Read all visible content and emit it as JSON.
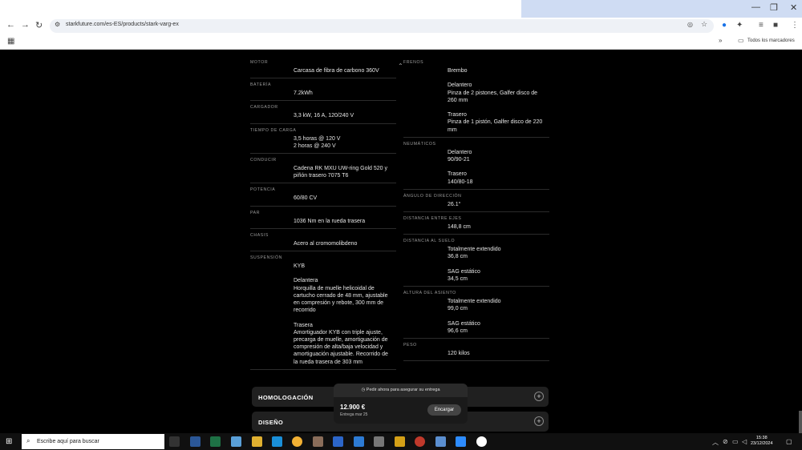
{
  "browser": {
    "url": "starkfuture.com/es-ES/products/stark-varg-ex",
    "bookmarks_label": "Todos los marcadores"
  },
  "specs_left": [
    {
      "label": "MOTOR",
      "lines": [
        "Carcasa de fibra de carbono 360V"
      ]
    },
    {
      "label": "BATERÍA",
      "lines": [
        "7.2kWh"
      ]
    },
    {
      "label": "CARGADOR",
      "lines": [
        "3,3 kW, 16 A, 120/240 V"
      ]
    },
    {
      "label": "TIEMPO DE CARGA",
      "lines": [
        "3,5 horas @ 120 V",
        "2 horas @ 240 V"
      ]
    },
    {
      "label": "CONDUCIR",
      "lines": [
        "Cadena RK MXU UW-ring Gold 520 y",
        "piñón trasero 7075 T6"
      ]
    },
    {
      "label": "POTENCIA",
      "lines": [
        "60/80 CV"
      ]
    },
    {
      "label": "PAR",
      "lines": [
        "1036 Nm en la rueda trasera"
      ]
    },
    {
      "label": "CHASIS",
      "lines": [
        "Acero al cromomolibdeno"
      ]
    },
    {
      "label": "SUSPENSIÓN",
      "lines": [
        "KYB",
        "",
        "Delantera",
        "Horquilla de muelle helicoidal de",
        "cartucho cerrado de 48 mm, ajustable",
        "en compresión y rebote, 300 mm de",
        "recorrido",
        "",
        "Trasera",
        "Amortiguador KYB con triple ajuste,",
        "precarga de muelle, amortiguación de",
        "compresión de alta/baja velocidad y",
        "amortiguación ajustable. Recorrido de",
        "la rueda trasera de 303 mm"
      ]
    }
  ],
  "specs_right": [
    {
      "label": "FRENOS",
      "lines": [
        "Brembo",
        "",
        "Delantero",
        "Pinza de 2 pistones, Galfer disco de",
        "260 mm",
        "",
        "Trasero",
        "Pinza de 1 pistón, Galfer disco de 220",
        "mm"
      ]
    },
    {
      "label": "NEUMÁTICOS",
      "lines": [
        "Delantero",
        "90/90-21",
        "",
        "Trasero",
        "140/80-18"
      ]
    },
    {
      "label": "ÁNGULO DE DIRECCIÓN",
      "lines": [
        "26.1°"
      ]
    },
    {
      "label": "DISTANCIA ENTRE EJES",
      "lines": [
        "148,8 cm"
      ]
    },
    {
      "label": "DISTANCIA AL SUELO",
      "lines": [
        "Totalmente extendido",
        "36,8 cm",
        "",
        "SAG estático",
        "34,5 cm"
      ]
    },
    {
      "label": "ALTURA DEL ASIENTO",
      "lines": [
        "Totalmente extendido",
        "99,0 cm",
        "",
        "SAG estático",
        "96,6 cm"
      ]
    },
    {
      "label": "PESO",
      "lines": [
        "120 kilos"
      ]
    }
  ],
  "accordions": [
    {
      "title": "HOMOLOGACIÓN"
    },
    {
      "title": "DISEÑO"
    }
  ],
  "order_popup": {
    "banner": "Pedir ahora para asegurar su entrega",
    "price": "12.900 €",
    "delivery": "Entrega mar 25",
    "button": "Encargar"
  },
  "taskbar": {
    "search_placeholder": "Escribe aquí para buscar",
    "time": "15:38",
    "date": "23/12/2024"
  }
}
